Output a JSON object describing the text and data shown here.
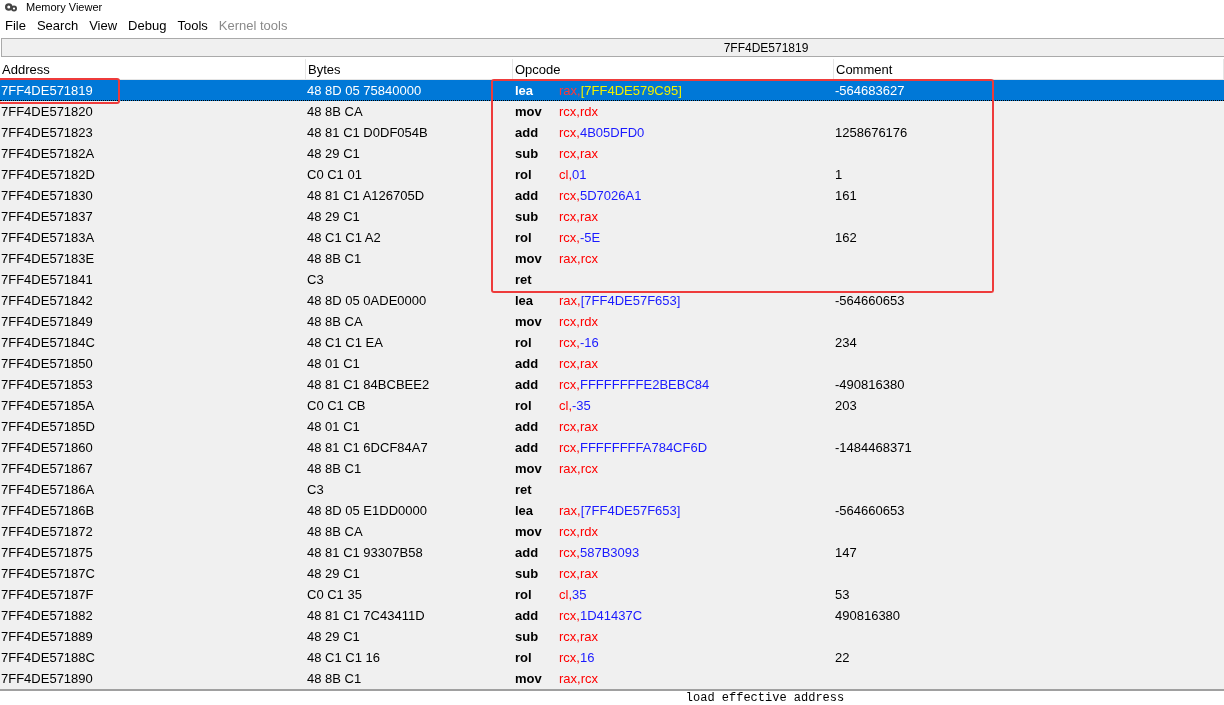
{
  "window": {
    "title": "Memory Viewer"
  },
  "menu": [
    {
      "label": "File",
      "disabled": false
    },
    {
      "label": "Search",
      "disabled": false
    },
    {
      "label": "View",
      "disabled": false
    },
    {
      "label": "Debug",
      "disabled": false
    },
    {
      "label": "Tools",
      "disabled": false
    },
    {
      "label": "Kernel tools",
      "disabled": true
    }
  ],
  "address_bar": "7FF4DE571819",
  "columns": [
    "Address",
    "Bytes",
    "Opcode",
    "Comment"
  ],
  "rows": [
    {
      "address": "7FF4DE571819",
      "bytes": "48 8D 05 75840000",
      "mnemonic": "lea",
      "operands": [
        {
          "text": "rax,",
          "kind": "register"
        },
        {
          "text": "[7FF4DE579C95]",
          "kind": "value"
        }
      ],
      "comment": "-564683627",
      "selected": true,
      "address_marked": true,
      "boxed": true
    },
    {
      "address": "7FF4DE571820",
      "bytes": "48 8B CA",
      "mnemonic": "mov",
      "operands": [
        {
          "text": "rcx,",
          "kind": "register"
        },
        {
          "text": "rdx",
          "kind": "register"
        }
      ],
      "selected": false,
      "address_marked": false,
      "boxed": true
    },
    {
      "address": "7FF4DE571823",
      "bytes": "48 81 C1 D0DF054B",
      "mnemonic": "add",
      "operands": [
        {
          "text": "rcx,",
          "kind": "register"
        },
        {
          "text": "4B05DFD0",
          "kind": "value"
        }
      ],
      "comment": "1258676176",
      "selected": false,
      "address_marked": false,
      "boxed": true
    },
    {
      "address": "7FF4DE57182A",
      "bytes": "48 29 C1",
      "mnemonic": "sub",
      "operands": [
        {
          "text": "rcx,",
          "kind": "register"
        },
        {
          "text": "rax",
          "kind": "register"
        }
      ],
      "selected": false,
      "address_marked": false,
      "boxed": true
    },
    {
      "address": "7FF4DE57182D",
      "bytes": "C0 C1 01",
      "mnemonic": "rol",
      "operands": [
        {
          "text": "cl,",
          "kind": "register"
        },
        {
          "text": "01",
          "kind": "value"
        }
      ],
      "comment": "1",
      "selected": false,
      "address_marked": false,
      "boxed": true
    },
    {
      "address": "7FF4DE571830",
      "bytes": "48 81 C1 A126705D",
      "mnemonic": "add",
      "operands": [
        {
          "text": "rcx,",
          "kind": "register"
        },
        {
          "text": "5D7026A1",
          "kind": "value"
        }
      ],
      "comment": "161",
      "selected": false,
      "address_marked": false,
      "boxed": true
    },
    {
      "address": "7FF4DE571837",
      "bytes": "48 29 C1",
      "mnemonic": "sub",
      "operands": [
        {
          "text": "rcx,",
          "kind": "register"
        },
        {
          "text": "rax",
          "kind": "register"
        }
      ],
      "selected": false,
      "address_marked": false,
      "boxed": true
    },
    {
      "address": "7FF4DE57183A",
      "bytes": "48 C1 C1 A2",
      "mnemonic": "rol",
      "operands": [
        {
          "text": "rcx,",
          "kind": "register"
        },
        {
          "text": "-5E",
          "kind": "value"
        }
      ],
      "comment": "162",
      "selected": false,
      "address_marked": false,
      "boxed": true
    },
    {
      "address": "7FF4DE57183E",
      "bytes": "48 8B C1",
      "mnemonic": "mov",
      "operands": [
        {
          "text": "rax,",
          "kind": "register"
        },
        {
          "text": "rcx",
          "kind": "register"
        }
      ],
      "selected": false,
      "address_marked": false,
      "boxed": true
    },
    {
      "address": "7FF4DE571841",
      "bytes": "C3",
      "mnemonic": "ret",
      "selected": false,
      "address_marked": false,
      "boxed": true
    },
    {
      "address": "7FF4DE571842",
      "bytes": "48 8D 05 0ADE0000",
      "mnemonic": "lea",
      "operands": [
        {
          "text": "rax,",
          "kind": "register"
        },
        {
          "text": "[7FF4DE57F653]",
          "kind": "value"
        }
      ],
      "comment": "-564660653",
      "selected": false,
      "address_marked": false,
      "boxed": false
    },
    {
      "address": "7FF4DE571849",
      "bytes": "48 8B CA",
      "mnemonic": "mov",
      "operands": [
        {
          "text": "rcx,",
          "kind": "register"
        },
        {
          "text": "rdx",
          "kind": "register"
        }
      ],
      "selected": false,
      "address_marked": false,
      "boxed": false
    },
    {
      "address": "7FF4DE57184C",
      "bytes": "48 C1 C1 EA",
      "mnemonic": "rol",
      "operands": [
        {
          "text": "rcx,",
          "kind": "register"
        },
        {
          "text": "-16",
          "kind": "value"
        }
      ],
      "comment": "234",
      "selected": false,
      "address_marked": false,
      "boxed": false
    },
    {
      "address": "7FF4DE571850",
      "bytes": "48 01 C1",
      "mnemonic": "add",
      "operands": [
        {
          "text": "rcx,",
          "kind": "register"
        },
        {
          "text": "rax",
          "kind": "register"
        }
      ],
      "selected": false,
      "address_marked": false,
      "boxed": false
    },
    {
      "address": "7FF4DE571853",
      "bytes": "48 81 C1 84BCBEE2",
      "mnemonic": "add",
      "operands": [
        {
          "text": "rcx,",
          "kind": "register"
        },
        {
          "text": "FFFFFFFFE2BEBC84",
          "kind": "value"
        }
      ],
      "comment": "-490816380",
      "selected": false,
      "address_marked": false,
      "boxed": false
    },
    {
      "address": "7FF4DE57185A",
      "bytes": "C0 C1 CB",
      "mnemonic": "rol",
      "operands": [
        {
          "text": "cl,",
          "kind": "register"
        },
        {
          "text": "-35",
          "kind": "value"
        }
      ],
      "comment": "203",
      "selected": false,
      "address_marked": false,
      "boxed": false
    },
    {
      "address": "7FF4DE57185D",
      "bytes": "48 01 C1",
      "mnemonic": "add",
      "operands": [
        {
          "text": "rcx,",
          "kind": "register"
        },
        {
          "text": "rax",
          "kind": "register"
        }
      ],
      "selected": false,
      "address_marked": false,
      "boxed": false
    },
    {
      "address": "7FF4DE571860",
      "bytes": "48 81 C1 6DCF84A7",
      "mnemonic": "add",
      "operands": [
        {
          "text": "rcx,",
          "kind": "register"
        },
        {
          "text": "FFFFFFFFA784CF6D",
          "kind": "value"
        }
      ],
      "comment": "-1484468371",
      "selected": false,
      "address_marked": false,
      "boxed": false
    },
    {
      "address": "7FF4DE571867",
      "bytes": "48 8B C1",
      "mnemonic": "mov",
      "operands": [
        {
          "text": "rax,",
          "kind": "register"
        },
        {
          "text": "rcx",
          "kind": "register"
        }
      ],
      "selected": false,
      "address_marked": false,
      "boxed": false
    },
    {
      "address": "7FF4DE57186A",
      "bytes": "C3",
      "mnemonic": "ret",
      "selected": false,
      "address_marked": false,
      "boxed": false
    },
    {
      "address": "7FF4DE57186B",
      "bytes": "48 8D 05 E1DD0000",
      "mnemonic": "lea",
      "operands": [
        {
          "text": "rax,",
          "kind": "register"
        },
        {
          "text": "[7FF4DE57F653]",
          "kind": "value"
        }
      ],
      "comment": "-564660653",
      "selected": false,
      "address_marked": false,
      "boxed": false
    },
    {
      "address": "7FF4DE571872",
      "bytes": "48 8B CA",
      "mnemonic": "mov",
      "operands": [
        {
          "text": "rcx,",
          "kind": "register"
        },
        {
          "text": "rdx",
          "kind": "register"
        }
      ],
      "selected": false,
      "address_marked": false,
      "boxed": false
    },
    {
      "address": "7FF4DE571875",
      "bytes": "48 81 C1 93307B58",
      "mnemonic": "add",
      "operands": [
        {
          "text": "rcx,",
          "kind": "register"
        },
        {
          "text": "587B3093",
          "kind": "value"
        }
      ],
      "comment": "147",
      "selected": false,
      "address_marked": false,
      "boxed": false
    },
    {
      "address": "7FF4DE57187C",
      "bytes": "48 29 C1",
      "mnemonic": "sub",
      "operands": [
        {
          "text": "rcx,",
          "kind": "register"
        },
        {
          "text": "rax",
          "kind": "register"
        }
      ],
      "selected": false,
      "address_marked": false,
      "boxed": false
    },
    {
      "address": "7FF4DE57187F",
      "bytes": "C0 C1 35",
      "mnemonic": "rol",
      "operands": [
        {
          "text": "cl,",
          "kind": "register"
        },
        {
          "text": "35",
          "kind": "value"
        }
      ],
      "comment": "53",
      "selected": false,
      "address_marked": false,
      "boxed": false
    },
    {
      "address": "7FF4DE571882",
      "bytes": "48 81 C1 7C43411D",
      "mnemonic": "add",
      "operands": [
        {
          "text": "rcx,",
          "kind": "register"
        },
        {
          "text": "1D41437C",
          "kind": "value"
        }
      ],
      "comment": "490816380",
      "selected": false,
      "address_marked": false,
      "boxed": false
    },
    {
      "address": "7FF4DE571889",
      "bytes": "48 29 C1",
      "mnemonic": "sub",
      "operands": [
        {
          "text": "rcx,",
          "kind": "register"
        },
        {
          "text": "rax",
          "kind": "register"
        }
      ],
      "selected": false,
      "address_marked": false,
      "boxed": false
    },
    {
      "address": "7FF4DE57188C",
      "bytes": "48 C1 C1 16",
      "mnemonic": "rol",
      "operands": [
        {
          "text": "rcx,",
          "kind": "register"
        },
        {
          "text": "16",
          "kind": "value"
        }
      ],
      "comment": "22",
      "selected": false,
      "address_marked": false,
      "boxed": false
    },
    {
      "address": "7FF4DE571890",
      "bytes": "48 8B C1",
      "mnemonic": "mov",
      "operands": [
        {
          "text": "rax,",
          "kind": "register"
        },
        {
          "text": "rcx",
          "kind": "register"
        }
      ],
      "selected": false,
      "address_marked": false,
      "boxed": false
    }
  ],
  "status_bar": "load effective address"
}
